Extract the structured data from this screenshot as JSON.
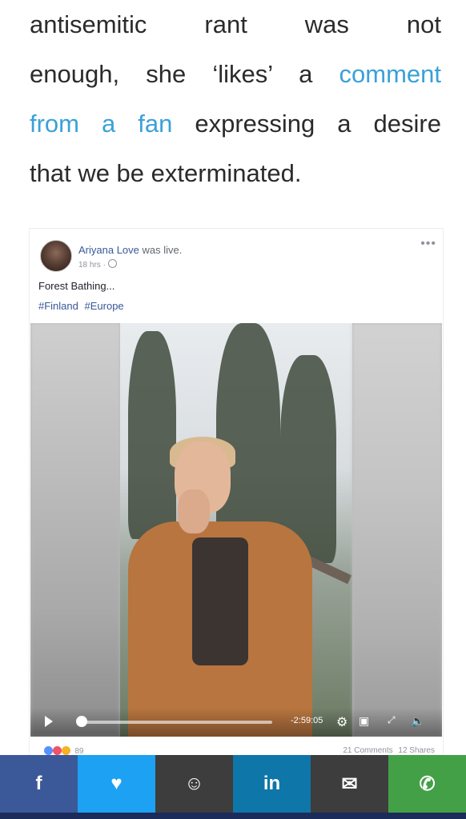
{
  "article": {
    "line1": "antisemitic rant was not",
    "line2_prefix": "enough, she ‘likes’ a",
    "line2_link": "comment",
    "line3_link": "from a fan",
    "line3_suffix": "expressing a desire",
    "line4": "that we be exterminated."
  },
  "post": {
    "author_name": "Ariyana Love",
    "author_suffix": "was live.",
    "time": "18 hrs ·",
    "more": "•••",
    "caption": "Forest Bathing...",
    "tags": [
      "#Finland",
      "#Europe"
    ],
    "video": {
      "timecode": "-2:59:05",
      "icons": [
        "play-icon",
        "settings-icon",
        "picture-in-picture-icon",
        "fullscreen-icon",
        "volume-icon"
      ]
    },
    "reactions_count": "89",
    "comments": "21 Comments",
    "shares": "12 Shares"
  },
  "share_bar": [
    {
      "name": "facebook",
      "glyph": "f",
      "color": "#3b5998"
    },
    {
      "name": "twitter",
      "glyph": "♥",
      "color": "#1da1f2"
    },
    {
      "name": "reddit",
      "glyph": "☺",
      "color": "#3d3d3d"
    },
    {
      "name": "linkedin",
      "glyph": "in",
      "color": "#0e76a8"
    },
    {
      "name": "email",
      "glyph": "✉",
      "color": "#3d3d3d"
    },
    {
      "name": "whatsapp",
      "glyph": "✆",
      "color": "#43a047"
    }
  ]
}
